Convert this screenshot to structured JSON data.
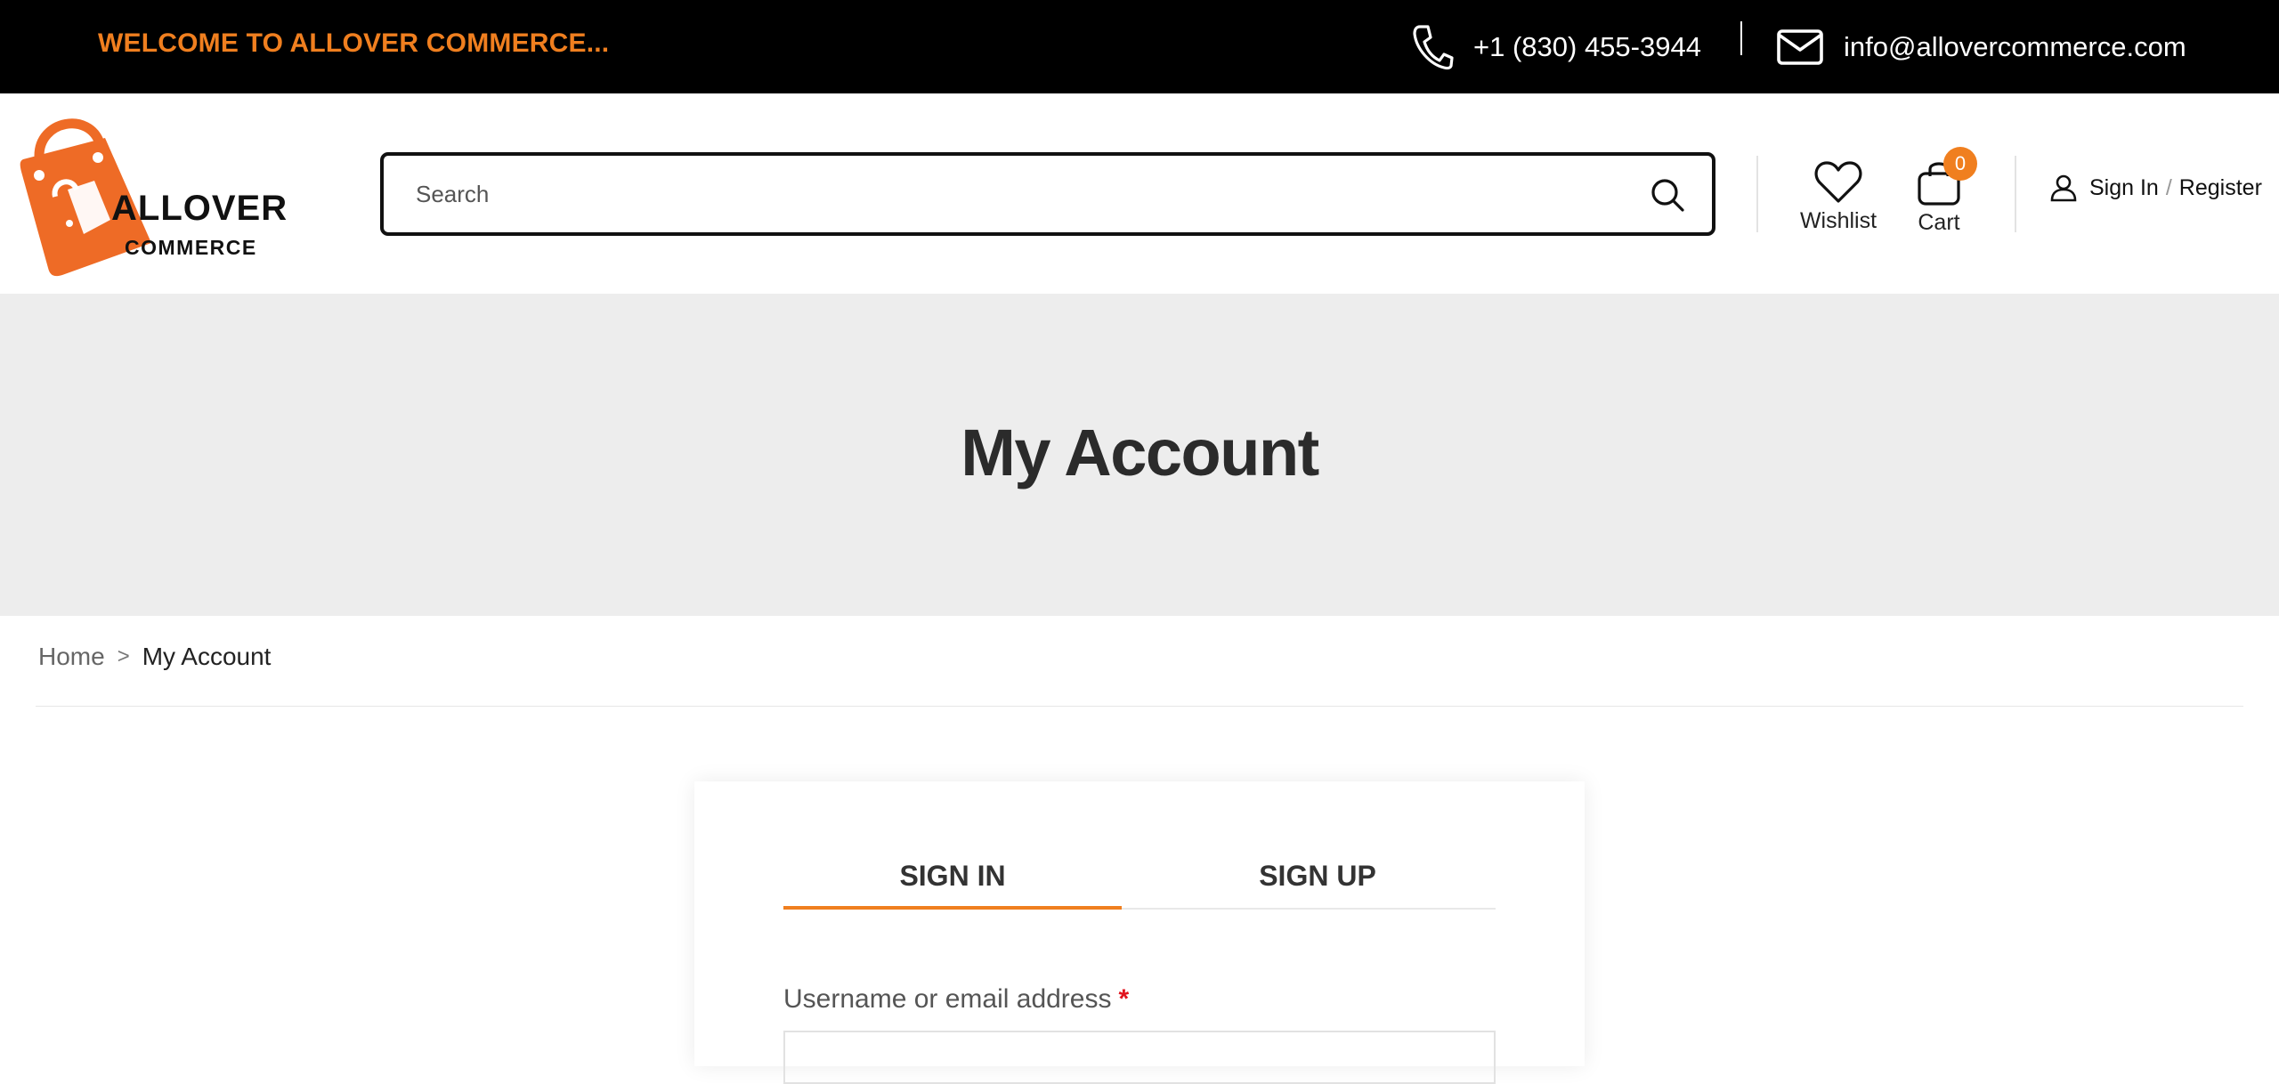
{
  "topbar": {
    "welcome": "WELCOME TO ALLOVER COMMERCE...",
    "phone": "+1 (830) 455-3944",
    "email": "info@allovercommerce.com"
  },
  "logo": {
    "brand_line1": "ALLOVER",
    "brand_line2": "COMMERCE"
  },
  "search": {
    "placeholder": "Search"
  },
  "header": {
    "wishlist_label": "Wishlist",
    "cart_label": "Cart",
    "cart_count": "0",
    "sign_in_label": "Sign In",
    "separator": "/",
    "register_label": "Register"
  },
  "banner": {
    "title": "My Account"
  },
  "breadcrumb": {
    "home": "Home",
    "separator": ">",
    "current": "My Account"
  },
  "auth": {
    "tab_signin": "SIGN IN",
    "tab_signup": "SIGN UP",
    "username_label": "Username or email address",
    "required_marker": "*"
  },
  "colors": {
    "accent": "#f07f1f",
    "topbar_bg": "#000000",
    "banner_bg": "#ededed"
  }
}
